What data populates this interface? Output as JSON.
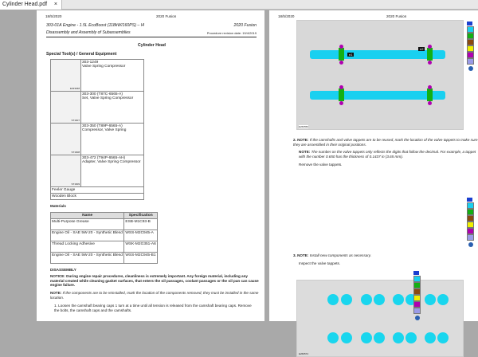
{
  "tab": {
    "title": "Cylinder Head.pdf",
    "close": "×"
  },
  "left": {
    "date": "18/5/2020",
    "model": "2020 Fusion",
    "engine": "303-01A Engine - 1.5L EcoBoost (118kW/160PS) – I4",
    "section": "Disassembly and Assembly of Subassemblies",
    "model_right": "2020 Fusion",
    "revision": "Procedure revision date: 19/4/2019",
    "title": "Cylinder Head",
    "tools_heading": "Special Tool(s) / General Equipment",
    "tools": [
      {
        "code": "303-1249",
        "name": "Valve Spring Compressor",
        "img": "E323048"
      },
      {
        "code": "303-300 (T87C-6565-A)",
        "name": "Set, Valve Spring Compressor",
        "img": "ST1607"
      },
      {
        "code": "303-350 (T89P-6565-A)",
        "name": "Compressor, Valve Spring",
        "img": "ST1608"
      },
      {
        "code": "303-472 (T94P-6565-AH)",
        "name": "Adapter, Valve Spring Compressor",
        "img": "ST1609"
      }
    ],
    "equipment": [
      "Feeler Gauge",
      "Wooden Block"
    ],
    "materials_heading": "Materials",
    "materials_cols": [
      "Name",
      "Specification"
    ],
    "materials": [
      [
        "Multi-Purpose Grease",
        "ESB-M1C93-B"
      ],
      [
        "Engine Oil - SAE 5W-20 - Synthetic Blend",
        "WSS-M2C945-A"
      ],
      [
        "Thread Locking Adhesive",
        "WSK-M2G351-A6"
      ],
      [
        "Engine Oil - SAE 5W-20 - Synthetic Blend",
        "WSS-M2C945-B1"
      ]
    ],
    "disassembly": "DISASSEMBLY",
    "notice": "NOTICE: During engine repair procedures, cleanliness is extremely important. Any foreign material, including any material created while cleaning gasket surfaces, that enters the oil passages, coolant passages or the oil pan can cause engine failure.",
    "note_label": "NOTE:",
    "note": "If the components are to be reinstalled, mark the location of the components removed, they must be installed in the same location.",
    "step1": "1. Loosen the camshaft bearing caps 1 turn at a time until all tension is released from the camshaft bearing caps. Remove the bolts, the camshaft caps and the camshafts."
  },
  "right": {
    "date": "18/5/2020",
    "model": "2020 Fusion",
    "fig1_id": "E260550",
    "fig1_labels": [
      "n1",
      "n2"
    ],
    "step2_label": "2. NOTE:",
    "step2_note": "If the camshafts and valve tappets are to be reused, mark the location of the valve tappets to make sure they are assembled in their original positions.",
    "note2_label": "NOTE:",
    "note2": "The number on the valve tappets only reflects the digits that follow the decimal. For example, a tappet with the number 0.650 has the thickness of 0.1437 in (3.65 mm).",
    "remove": "Remove the valve tappets.",
    "fig2_id": "E260574",
    "step3_label": "3. NOTE:",
    "step3_note": "Install new components as necessary.",
    "inspect": "Inspect the valve tappets.",
    "legend_colors": [
      "#19d0f0",
      "#13b013",
      "#8b4a10",
      "#f0f000",
      "#b000b0",
      "#9b9be8"
    ],
    "legend_title": "Tab"
  }
}
